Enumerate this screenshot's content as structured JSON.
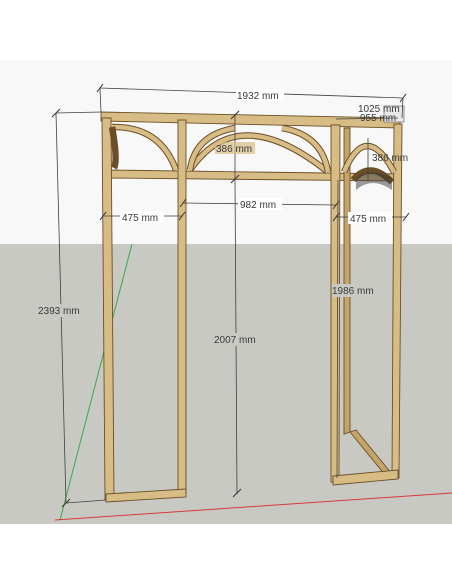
{
  "scene": {
    "sky_color": "#ffffff",
    "ground_color": "#c9c9c4",
    "axis_green": "#3aa84a",
    "axis_red": "#d83a3a",
    "wood_color": "#d8bc85",
    "wood_edge_color": "#6b4f26"
  },
  "dimensions": {
    "overall_width": "1932 mm",
    "right_depth_1": "1025 mm",
    "right_depth_2": "955 mm",
    "center_arch_height": "386 mm",
    "right_arch_height": "386 mm",
    "center_opening_width": "982 mm",
    "left_panel_width": "475 mm",
    "right_panel_width": "475 mm",
    "overall_height": "2393 mm",
    "opening_height": "2007 mm",
    "right_opening_height": "1986 mm"
  }
}
